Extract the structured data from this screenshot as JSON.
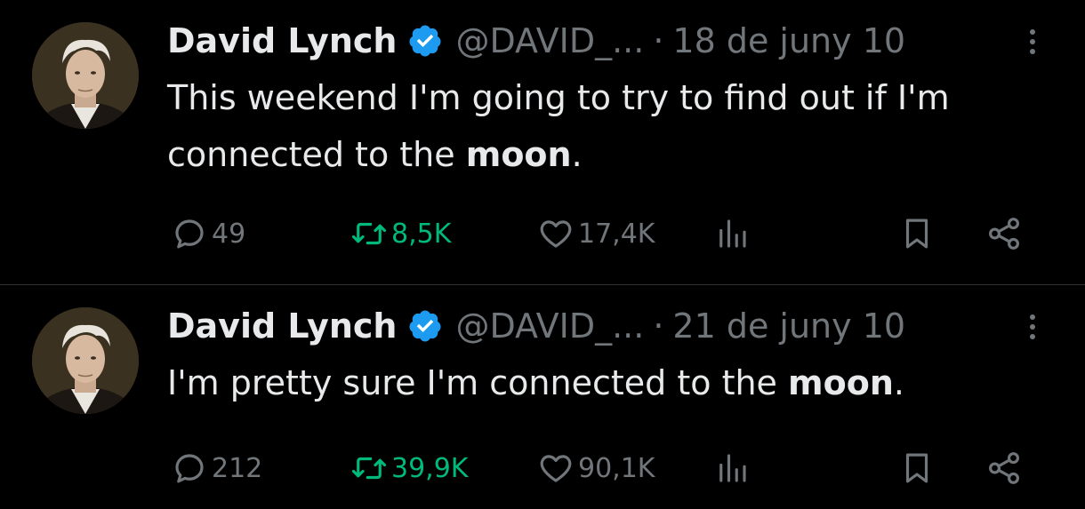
{
  "colors": {
    "background": "#000000",
    "text_primary": "#e7e9ea",
    "text_secondary": "#71767b",
    "retweet_green": "#00ba7c",
    "verified_blue": "#1d9bf0",
    "divider": "#2f3336"
  },
  "tweets": [
    {
      "author": {
        "name": "David Lynch",
        "handle": "@DAVID_...",
        "verified_icon": "verified-badge-icon",
        "avatar_icon": "profile-photo"
      },
      "separator": "·",
      "date": "18 de juny 10",
      "text": {
        "line1": "This weekend I'm going to try to find out if I'm",
        "line2_before": "connected to the ",
        "bold": "moon",
        "after": "."
      },
      "stats": {
        "replies": "49",
        "retweets": "8,5K",
        "likes": "17,4K"
      },
      "action_icons": [
        "reply-icon",
        "retweet-icon",
        "like-icon",
        "views-icon",
        "bookmark-icon",
        "share-icon"
      ]
    },
    {
      "author": {
        "name": "David Lynch",
        "handle": "@DAVID_...",
        "verified_icon": "verified-badge-icon",
        "avatar_icon": "profile-photo"
      },
      "separator": "·",
      "date": "21 de juny 10",
      "text": {
        "line1": "",
        "line2_before": "I'm pretty sure I'm connected to the ",
        "bold": "moon",
        "after": "."
      },
      "stats": {
        "replies": "212",
        "retweets": "39,9K",
        "likes": "90,1K"
      },
      "action_icons": [
        "reply-icon",
        "retweet-icon",
        "like-icon",
        "views-icon",
        "bookmark-icon",
        "share-icon"
      ]
    }
  ]
}
